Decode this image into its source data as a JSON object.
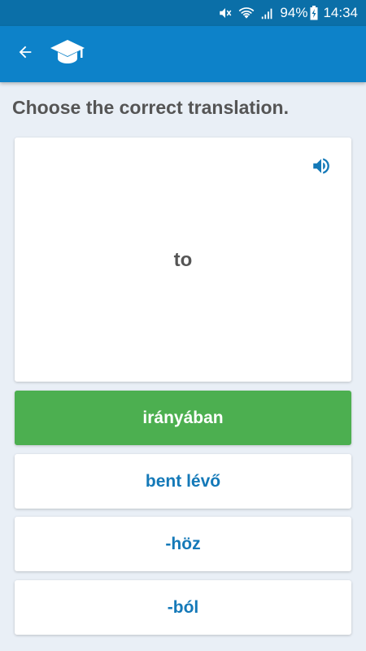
{
  "status_bar": {
    "battery": "94%",
    "time": "14:34",
    "icons": [
      "mute-icon",
      "wifi-icon",
      "signal-icon",
      "battery-charging-icon"
    ]
  },
  "app_bar": {
    "back_icon": "arrow-left-icon",
    "logo_icon": "graduation-cap-icon",
    "background": "#0d82c9"
  },
  "quiz": {
    "prompt": "Choose the correct translation.",
    "word": "to",
    "speaker_icon": "speaker-icon",
    "answers": [
      {
        "label": "irányában",
        "state": "correct"
      },
      {
        "label": "bent lévő",
        "state": "default"
      },
      {
        "label": "-höz",
        "state": "default"
      },
      {
        "label": "-ból",
        "state": "default"
      }
    ]
  },
  "colors": {
    "correct": "#4caf50",
    "answer_text": "#1479b8",
    "status_bar": "#0b6fa8",
    "background": "#e9eff6"
  }
}
